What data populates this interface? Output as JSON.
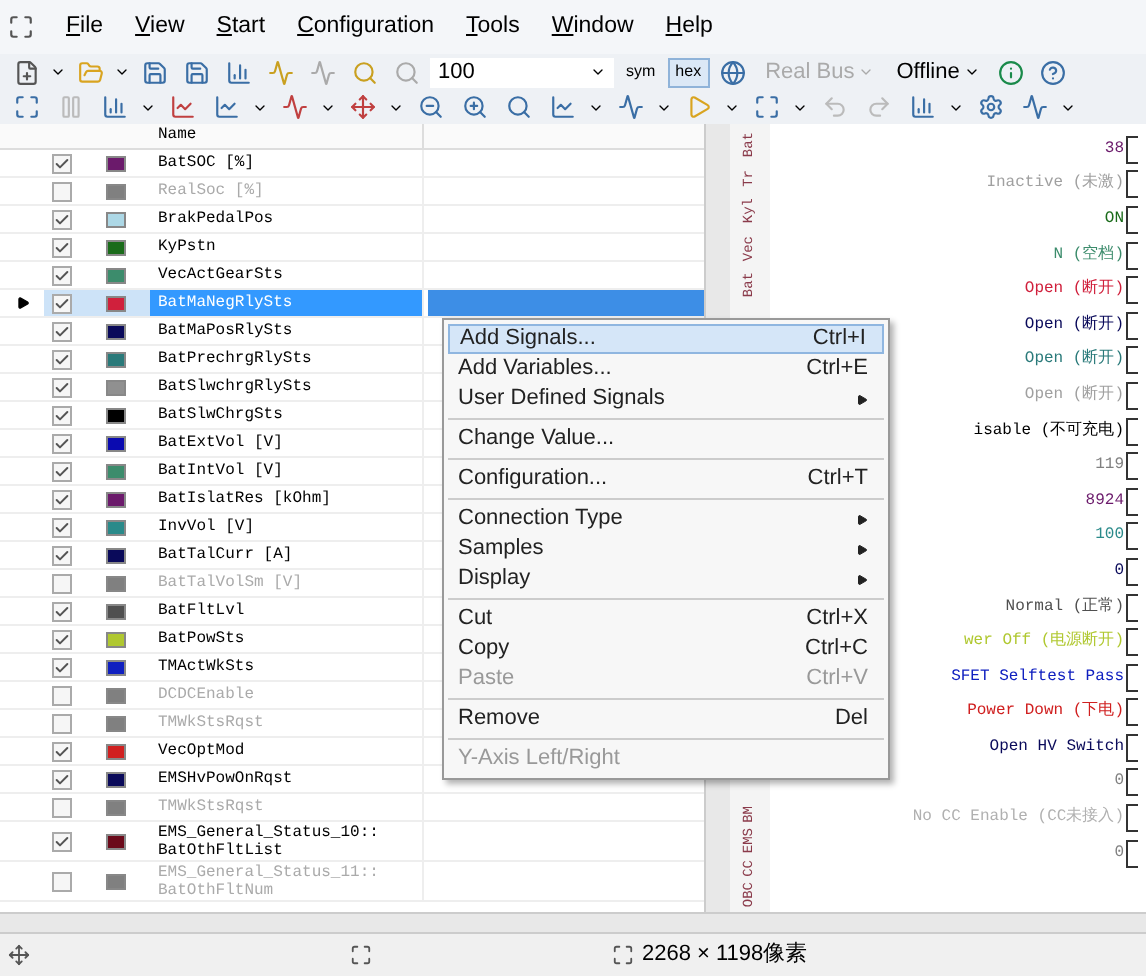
{
  "menu_bar": [
    "File",
    "View",
    "Start",
    "Configuration",
    "Tools",
    "Window",
    "Help"
  ],
  "toolbar": {
    "zoom_field": {
      "value": "100"
    },
    "sym_button": {
      "label": "sym",
      "selected": false
    },
    "hex_button": {
      "label": "hex",
      "selected": true
    },
    "real_bus": {
      "label": "Real Bus",
      "disabled": true
    },
    "offline": {
      "label": "Offline",
      "disabled": false
    }
  },
  "grid": {
    "columns": [
      "Name"
    ],
    "rows": [
      {
        "name": "BatSOC [%]",
        "checked": true,
        "color": "#6b1a6b",
        "selected": false
      },
      {
        "name": "RealSoc [%]",
        "checked": false,
        "color": "#808080",
        "selected": false
      },
      {
        "name": "BrakPedalPos",
        "checked": true,
        "color": "#add8e6",
        "selected": false
      },
      {
        "name": "KyPstn",
        "checked": true,
        "color": "#1a6b1a",
        "selected": false
      },
      {
        "name": "VecActGearSts",
        "checked": true,
        "color": "#3c8c6c",
        "selected": false
      },
      {
        "name": "BatMaNegRlySts",
        "checked": true,
        "color": "#d0203c",
        "selected": true
      },
      {
        "name": "BatMaPosRlySts",
        "checked": true,
        "color": "#0a0a5a",
        "selected": false
      },
      {
        "name": "BatPrechrgRlySts",
        "checked": true,
        "color": "#2a7a7a",
        "selected": false
      },
      {
        "name": "BatSlwchrgRlySts",
        "checked": true,
        "color": "#909090",
        "selected": false
      },
      {
        "name": "BatSlwChrgSts",
        "checked": true,
        "color": "#000000",
        "selected": false
      },
      {
        "name": "BatExtVol [V]",
        "checked": true,
        "color": "#0a0ab0",
        "selected": false
      },
      {
        "name": "BatIntVol [V]",
        "checked": true,
        "color": "#3c8c6c",
        "selected": false
      },
      {
        "name": "BatIslatRes [kOhm]",
        "checked": true,
        "color": "#6b1a6b",
        "selected": false
      },
      {
        "name": "InvVol [V]",
        "checked": true,
        "color": "#2a8a8a",
        "selected": false
      },
      {
        "name": "BatTalCurr [A]",
        "checked": true,
        "color": "#0a0a5a",
        "selected": false
      },
      {
        "name": "BatTalVolSm [V]",
        "checked": false,
        "color": "#808080",
        "selected": false
      },
      {
        "name": "BatFltLvl",
        "checked": true,
        "color": "#505050",
        "selected": false
      },
      {
        "name": "BatPowSts",
        "checked": true,
        "color": "#b0c830",
        "selected": false
      },
      {
        "name": "TMActWkSts",
        "checked": true,
        "color": "#1020c0",
        "selected": false
      },
      {
        "name": "DCDCEnable",
        "checked": false,
        "color": "#808080",
        "selected": false
      },
      {
        "name": "TMWkStsRqst",
        "checked": false,
        "color": "#808080",
        "selected": false
      },
      {
        "name": "VecOptMod",
        "checked": true,
        "color": "#d02020",
        "selected": false
      },
      {
        "name": "EMSHvPowOnRqst",
        "checked": true,
        "color": "#0a0a5a",
        "selected": false
      },
      {
        "name": "TMWkStsRqst",
        "checked": false,
        "color": "#808080",
        "selected": false
      },
      {
        "name": "EMS_General_Status_10::\nBatOthFltList",
        "checked": true,
        "color": "#6b0a1a",
        "selected": false
      },
      {
        "name": "EMS_General_Status_11::\nBatOthFltNum",
        "checked": false,
        "color": "#808080",
        "selected": false
      }
    ]
  },
  "plot": {
    "axis_labels_top": [
      "Bat",
      "Tr",
      "Kyl",
      "Vec",
      "Bat"
    ],
    "axis_labels_bottom": [
      "BM",
      "EMS",
      "CC",
      "OBC"
    ],
    "values": [
      {
        "text": "38",
        "color": "#6b1a6b"
      },
      {
        "text": "Inactive (未激)",
        "color": "#a0a0a0"
      },
      {
        "text": "ON",
        "color": "#1a6b1a"
      },
      {
        "text": "N (空档)",
        "color": "#3c8c6c"
      },
      {
        "text": "Open (断开)",
        "color": "#d0203c"
      },
      {
        "text": "Open (断开)",
        "color": "#0a0a5a"
      },
      {
        "text": "Open (断开)",
        "color": "#2a7a7a"
      },
      {
        "text": "Open (断开)",
        "color": "#a0a0a0"
      },
      {
        "text": "isable (不可充电)",
        "color": "#000000"
      },
      {
        "text": "119",
        "color": "#808080"
      },
      {
        "text": "8924",
        "color": "#6b1a6b"
      },
      {
        "text": "100",
        "color": "#2a8a8a"
      },
      {
        "text": "0",
        "color": "#0a0a5a"
      },
      {
        "text": "Normal (正常)",
        "color": "#505050"
      },
      {
        "text": "wer Off (电源断开)",
        "color": "#b0c830"
      },
      {
        "text": "SFET Selftest Pass",
        "color": "#1020c0"
      },
      {
        "text": "Power Down (下电)",
        "color": "#d02020"
      },
      {
        "text": "Open HV Switch",
        "color": "#0a0a5a"
      },
      {
        "text": "0",
        "color": "#808080"
      },
      {
        "text": "No CC Enable (CC未接入)",
        "color": "#b0b0b0"
      },
      {
        "text": "0",
        "color": "#808080"
      }
    ]
  },
  "context_menu": [
    {
      "kind": "item",
      "label": "Add Signals...",
      "shortcut": "Ctrl+I",
      "highlighted": true,
      "disabled": false,
      "submenu": false
    },
    {
      "kind": "item",
      "label": "Add Variables...",
      "shortcut": "Ctrl+E",
      "highlighted": false,
      "disabled": false,
      "submenu": false
    },
    {
      "kind": "item",
      "label": "User Defined Signals",
      "highlighted": false,
      "disabled": false,
      "submenu": true
    },
    {
      "kind": "separator"
    },
    {
      "kind": "item",
      "label": "Change Value...",
      "highlighted": false,
      "disabled": false,
      "submenu": false
    },
    {
      "kind": "separator"
    },
    {
      "kind": "item",
      "label": "Configuration...",
      "shortcut": "Ctrl+T",
      "highlighted": false,
      "disabled": false,
      "submenu": false
    },
    {
      "kind": "separator"
    },
    {
      "kind": "item",
      "label": "Connection Type",
      "highlighted": false,
      "disabled": false,
      "submenu": true
    },
    {
      "kind": "item",
      "label": "Samples",
      "highlighted": false,
      "disabled": false,
      "submenu": true
    },
    {
      "kind": "item",
      "label": "Display",
      "highlighted": false,
      "disabled": false,
      "submenu": true
    },
    {
      "kind": "separator"
    },
    {
      "kind": "item",
      "label": "Cut",
      "shortcut": "Ctrl+X",
      "highlighted": false,
      "disabled": false,
      "submenu": false
    },
    {
      "kind": "item",
      "label": "Copy",
      "shortcut": "Ctrl+C",
      "highlighted": false,
      "disabled": false,
      "submenu": false
    },
    {
      "kind": "item",
      "label": "Paste",
      "shortcut": "Ctrl+V",
      "highlighted": false,
      "disabled": true,
      "submenu": false
    },
    {
      "kind": "separator"
    },
    {
      "kind": "item",
      "label": "Remove",
      "shortcut": "Del",
      "highlighted": false,
      "disabled": false,
      "submenu": false
    },
    {
      "kind": "separator"
    },
    {
      "kind": "item",
      "label": "Y-Axis Left/Right",
      "highlighted": false,
      "disabled": true,
      "submenu": false
    }
  ],
  "status_bar": {
    "dimensions": "2268 × 1198像素"
  }
}
